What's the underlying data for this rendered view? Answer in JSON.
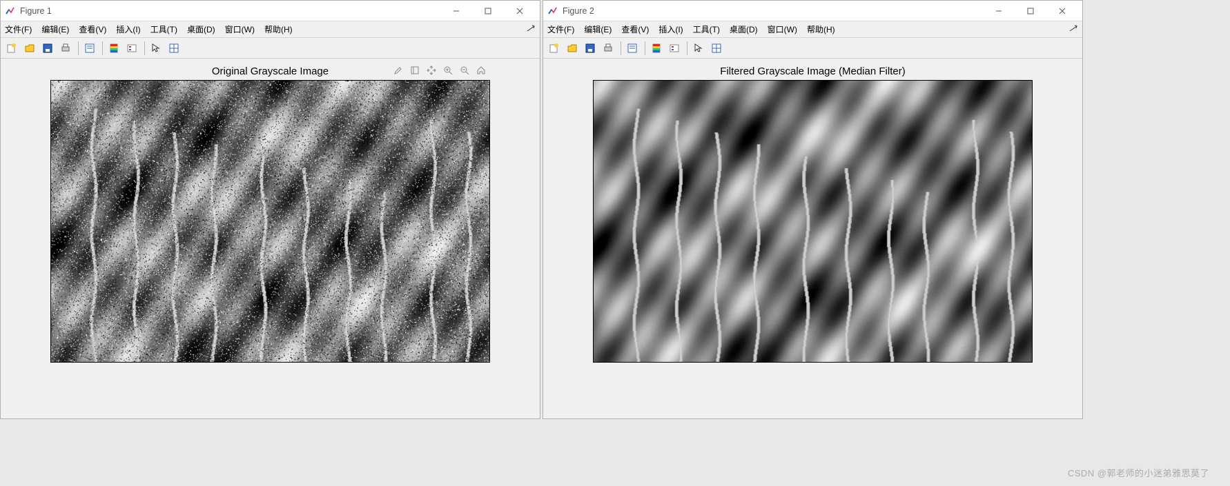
{
  "windows": [
    {
      "title": "Figure 1",
      "plot_title": "Original Grayscale Image",
      "show_axes_tools": true
    },
    {
      "title": "Figure 2",
      "plot_title": "Filtered Grayscale Image (Median Filter)",
      "show_axes_tools": false
    }
  ],
  "menu": {
    "file": "文件(F)",
    "edit": "编辑(E)",
    "view": "查看(V)",
    "insert": "插入(I)",
    "tools": "工具(T)",
    "desktop": "桌面(D)",
    "window": "窗口(W)",
    "help": "帮助(H)"
  },
  "toolbar_icons": [
    "new",
    "open",
    "save",
    "print",
    "sep",
    "print-preview",
    "sep",
    "colorbar",
    "legend",
    "sep",
    "pointer",
    "data-cursor"
  ],
  "axes_icons": [
    "brush",
    "restore",
    "pan",
    "zoom-in",
    "zoom-out",
    "home"
  ],
  "watermark": "CSDN @郭老师的小迷弟雅思莫了"
}
